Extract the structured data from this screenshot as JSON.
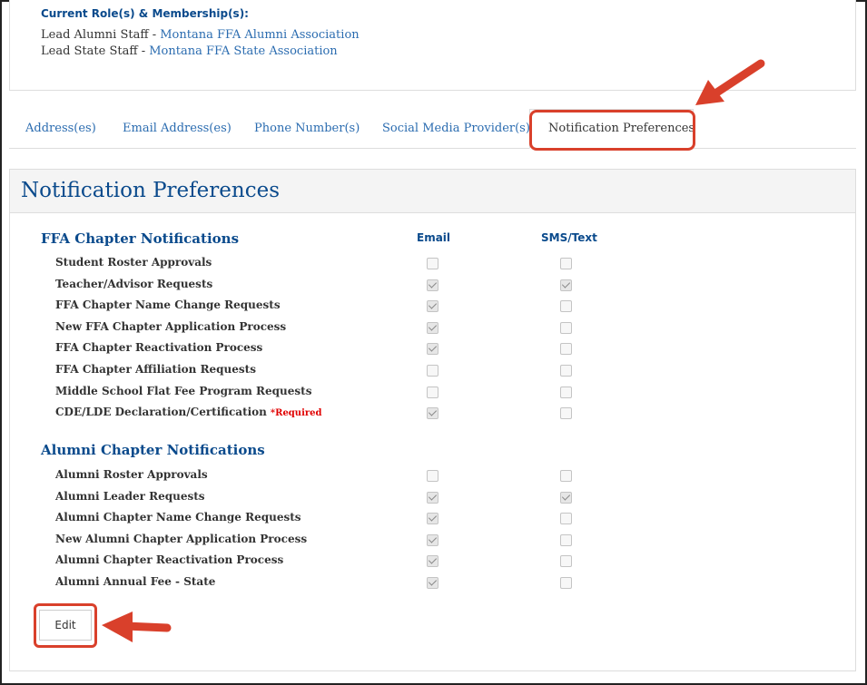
{
  "roles": {
    "heading": "Current Role(s) & Membership(s):",
    "items": [
      {
        "role": "Lead Alumni Staff",
        "separator": " - ",
        "org": "Montana FFA Alumni Association"
      },
      {
        "role": "Lead State Staff",
        "separator": " - ",
        "org": "Montana FFA State Association"
      }
    ]
  },
  "tabs": [
    {
      "label": "Address(es)",
      "active": false
    },
    {
      "label": "Email Address(es)",
      "active": false
    },
    {
      "label": "Phone Number(s)",
      "active": false
    },
    {
      "label": "Social Media Provider(s)",
      "active": false
    },
    {
      "label": "Notification Preferences",
      "active": true
    }
  ],
  "panel": {
    "title": "Notification Preferences",
    "columns": {
      "email": "Email",
      "sms": "SMS/Text"
    },
    "ffa_section": {
      "title": "FFA Chapter Notifications",
      "rows": [
        {
          "label": "Student Roster Approvals",
          "email": false,
          "sms": false
        },
        {
          "label": "Teacher/Advisor Requests",
          "email": true,
          "sms": true
        },
        {
          "label": "FFA Chapter Name Change Requests",
          "email": true,
          "sms": false
        },
        {
          "label": "New FFA Chapter Application Process",
          "email": true,
          "sms": false
        },
        {
          "label": "FFA Chapter Reactivation Process",
          "email": true,
          "sms": false
        },
        {
          "label": "FFA Chapter Affiliation Requests",
          "email": false,
          "sms": false
        },
        {
          "label": "Middle School Flat Fee Program Requests",
          "email": false,
          "sms": false
        },
        {
          "label": "CDE/LDE Declaration/Certification",
          "required": "*Required",
          "email": true,
          "sms": false
        }
      ]
    },
    "alumni_section": {
      "title": "Alumni Chapter Notifications",
      "rows": [
        {
          "label": "Alumni Roster Approvals",
          "email": false,
          "sms": false
        },
        {
          "label": "Alumni Leader Requests",
          "email": true,
          "sms": true
        },
        {
          "label": "Alumni Chapter Name Change Requests",
          "email": true,
          "sms": false
        },
        {
          "label": "New Alumni Chapter Application Process",
          "email": true,
          "sms": false
        },
        {
          "label": "Alumni Chapter Reactivation Process",
          "email": true,
          "sms": false
        },
        {
          "label": "Alumni Annual Fee - State",
          "email": true,
          "sms": false
        }
      ]
    },
    "edit_label": "Edit"
  },
  "colors": {
    "accent_blue": "#0a4a8c",
    "link_blue": "#2b6cb0",
    "annotation_red": "#d9402b",
    "required_red": "#e00000"
  }
}
